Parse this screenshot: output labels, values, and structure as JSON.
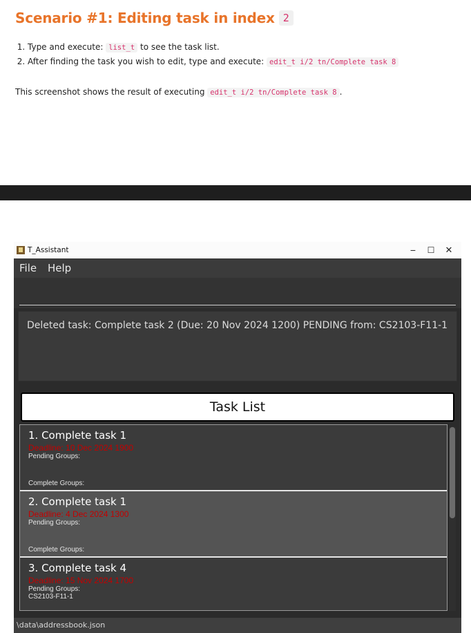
{
  "doc": {
    "heading": "Scenario #1: Editing task in index",
    "heading_index": "2",
    "steps": [
      {
        "prefix": "Type and execute:",
        "code": "list_t",
        "suffix": "to see the task list."
      },
      {
        "prefix": "After finding the task you wish to edit, type and execute:",
        "code": "edit_t i/2 tn/Complete task 8",
        "suffix": ""
      }
    ],
    "note_prefix": "This screenshot shows the result of executing",
    "note_code": "edit_t i/2 tn/Complete task 8",
    "note_suffix": "."
  },
  "app": {
    "window_title": "T_Assistant",
    "controls": {
      "minimize": "−",
      "maximize": "☐",
      "close": "✕"
    },
    "menu": [
      "File",
      "Help"
    ],
    "command_value": "",
    "result_text": "Deleted task: Complete task 2 (Due: 20 Nov 2024 1200) PENDING from: CS2103-F11-1",
    "task_list_title": "Task List",
    "tasks": [
      {
        "title": "1. Complete task 1",
        "deadline": "Deadline: 10 Dec 2024 1900",
        "pending_label": "Pending Groups:",
        "pending_groups": "",
        "complete_label": "Complete Groups:"
      },
      {
        "title": "2. Complete task 1",
        "deadline": "Deadline: 4 Dec 2024 1300",
        "pending_label": "Pending Groups:",
        "pending_groups": "",
        "complete_label": "Complete Groups:"
      },
      {
        "title": "3. Complete task 4",
        "deadline": "Deadline: 15 Nov 2024 1700",
        "pending_label": "Pending Groups:",
        "pending_groups": "CS2103-F11-1",
        "complete_label": ""
      }
    ],
    "status_path": "\\data\\addressbook.json",
    "colors": {
      "heading": "#e8742a",
      "deadline": "#c40000",
      "window_bg": "#2b2b2b"
    }
  }
}
